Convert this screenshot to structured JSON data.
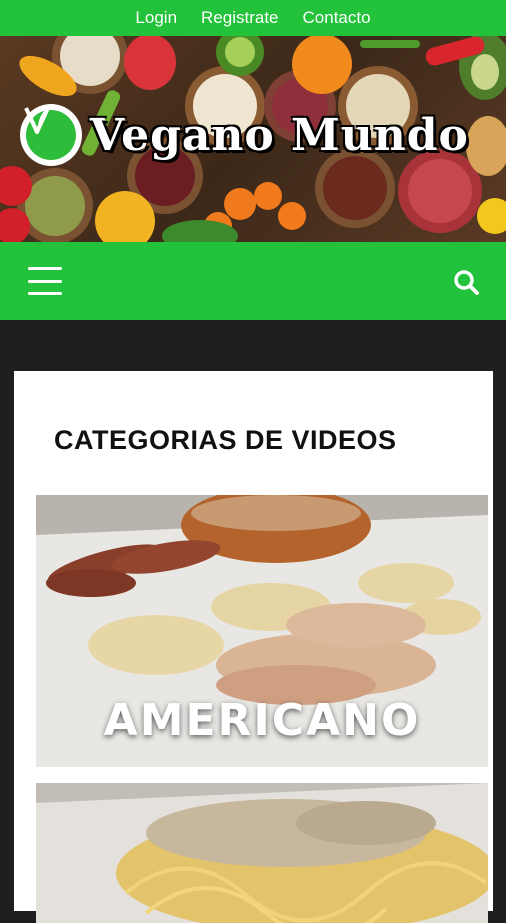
{
  "topnav": {
    "links": [
      "Login",
      "Registrate",
      "Contacto"
    ]
  },
  "brand": {
    "title": "Vegano Mundo"
  },
  "colors": {
    "green": "#22c23a",
    "dark_bg": "#1f1f1f",
    "card": "#ffffff"
  },
  "icons": {
    "menu": "hamburger-menu-icon",
    "search": "search-icon",
    "logo": "vegan-leaf-icon"
  },
  "content": {
    "section_title": "CATEGORIAS DE VIDEOS",
    "videos": [
      {
        "caption": "AMERICANO"
      },
      {
        "caption": ""
      }
    ]
  }
}
